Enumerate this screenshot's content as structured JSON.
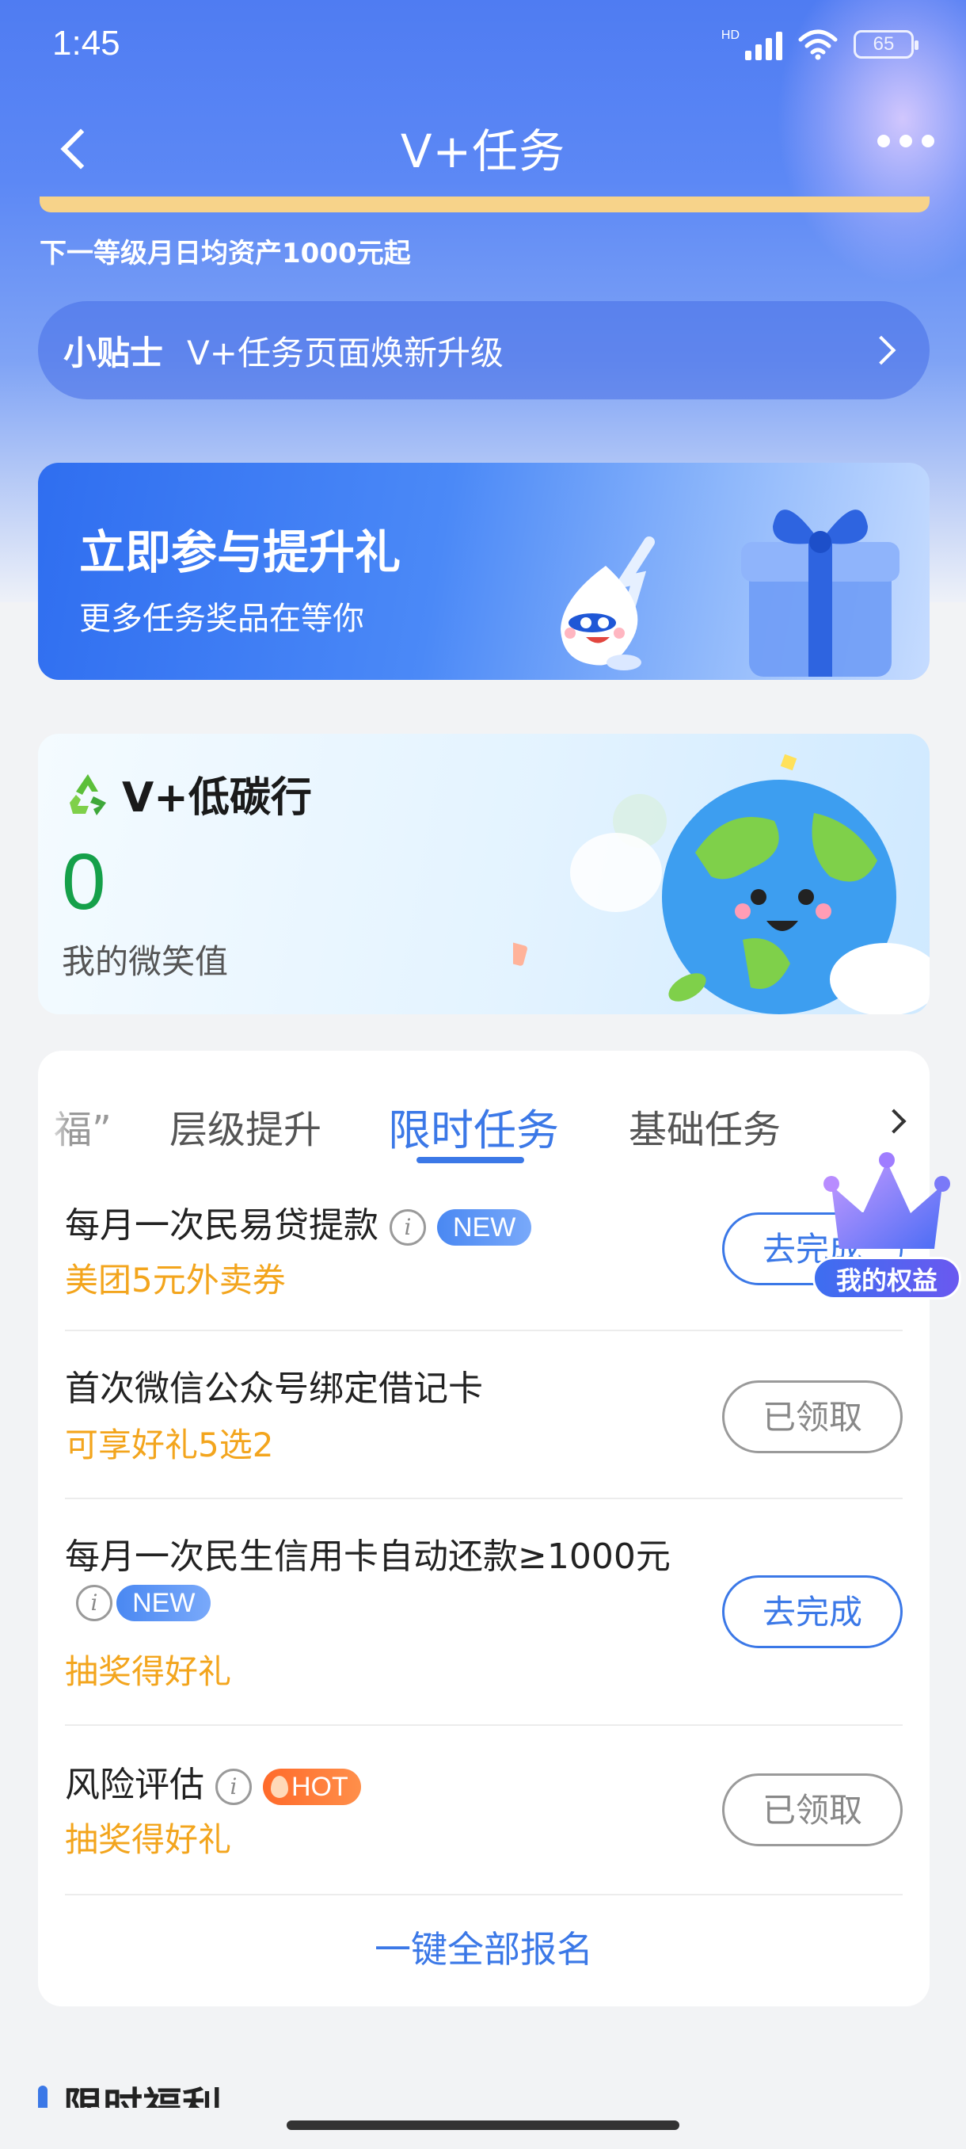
{
  "status_bar": {
    "time": "1:45",
    "network": "HD",
    "battery": "65"
  },
  "nav": {
    "title": "V+任务"
  },
  "level_hint": "下一等级月日均资产1000元起",
  "tip": {
    "label": "小贴士",
    "text": "V+任务页面焕新升级"
  },
  "promo": {
    "title": "立即参与提升礼",
    "subtitle": "更多任务奖品在等你"
  },
  "carbon": {
    "title": "V+低碳行",
    "value": "0",
    "label": "我的微笑值"
  },
  "tabs": [
    {
      "label": "福”",
      "active": false
    },
    {
      "label": "层级提升",
      "active": false
    },
    {
      "label": "限时任务",
      "active": true
    },
    {
      "label": "基础任务",
      "active": false
    }
  ],
  "tasks": [
    {
      "name": "每月一次民易贷提款",
      "badge": "NEW",
      "reward": "美团5元外卖券",
      "button": "去完成"
    },
    {
      "name": "首次微信公众号绑定借记卡",
      "badge": "",
      "reward": "可享好礼5选2",
      "button": "已领取"
    },
    {
      "name": "每月一次民生信用卡自动还款≥1000元",
      "badge": "NEW",
      "reward": "抽奖得好礼",
      "button": "去完成"
    },
    {
      "name": "风险评估",
      "badge": "HOT",
      "reward": "抽奖得好礼",
      "button": "已领取"
    }
  ],
  "info_glyph": "i",
  "enroll_all": "一键全部报名",
  "rights_label": "我的权益",
  "section_title": "限时福利",
  "colors": {
    "primary": "#3b78e7",
    "reward": "#f3a51d",
    "carbon": "#15a04a",
    "hot": "#ff6a2a"
  }
}
